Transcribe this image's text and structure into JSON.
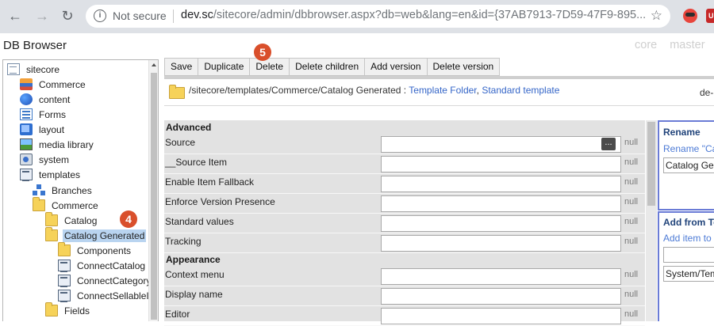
{
  "browser": {
    "security_label": "Not secure",
    "url_host": "dev.sc",
    "url_path": "/sitecore/admin/dbbrowser.aspx?db=web&lang=en&id={37AB7913-7D59-47F9-895..."
  },
  "app": {
    "title": "DB Browser",
    "databases": [
      "core",
      "master"
    ]
  },
  "tree": {
    "items": [
      {
        "label": "sitecore",
        "icon": "page-icon"
      },
      {
        "label": "Commerce",
        "icon": "commerce-icon"
      },
      {
        "label": "content",
        "icon": "content-icon"
      },
      {
        "label": "Forms",
        "icon": "forms-icon"
      },
      {
        "label": "layout",
        "icon": "layout-icon"
      },
      {
        "label": "media library",
        "icon": "media-icon"
      },
      {
        "label": "system",
        "icon": "system-icon"
      },
      {
        "label": "templates",
        "icon": "templates-icon"
      },
      {
        "label": "Branches",
        "icon": "branches-icon"
      },
      {
        "label": "Commerce",
        "icon": "folder-icon"
      },
      {
        "label": "Catalog",
        "icon": "folder-icon"
      },
      {
        "label": "Catalog Generated",
        "icon": "folder-icon",
        "selected": true
      },
      {
        "label": "Components",
        "icon": "folder-icon"
      },
      {
        "label": "ConnectCatalog",
        "icon": "template-icon"
      },
      {
        "label": "ConnectCategory",
        "icon": "template-icon"
      },
      {
        "label": "ConnectSellableIte",
        "icon": "template-icon"
      },
      {
        "label": "Fields",
        "icon": "folder-icon"
      }
    ]
  },
  "toolbar": {
    "save": "Save",
    "duplicate": "Duplicate",
    "delete": "Delete",
    "delete_children": "Delete children",
    "add_version": "Add version",
    "delete_version": "Delete version"
  },
  "item": {
    "path": "/sitecore/templates/Commerce/Catalog Generated",
    "separator": " : ",
    "template_link": "Template Folder",
    "comma": ", ",
    "standard_link": "Standard template",
    "lang_trunc": "de-"
  },
  "fields": {
    "advanced_header": "Advanced",
    "appearance_header": "Appearance",
    "null_label": "null",
    "dots": "...",
    "advanced": [
      {
        "label": "Source",
        "value": ""
      },
      {
        "label": "__Source Item",
        "value": ""
      },
      {
        "label": "Enable Item Fallback",
        "value": ""
      },
      {
        "label": "Enforce Version Presence",
        "value": ""
      },
      {
        "label": "Standard values",
        "value": ""
      },
      {
        "label": "Tracking",
        "value": ""
      }
    ],
    "appearance": [
      {
        "label": "Context menu",
        "value": ""
      },
      {
        "label": "Display name",
        "value": ""
      },
      {
        "label": "Editor",
        "value": ""
      }
    ]
  },
  "rename_panel": {
    "title": "Rename",
    "subtitle": "Rename \"Cat",
    "input_value": "Catalog Gene"
  },
  "add_panel": {
    "title": "Add from Te",
    "subtitle": "Add item to \"",
    "input_value": "",
    "template_value": "System/Tem"
  },
  "badges": {
    "delete_step": "5",
    "tree_step": "4"
  },
  "colors": {
    "accent": "#6a7bd6",
    "badge": "#d94f2b",
    "link": "#3566c8",
    "selection": "#b9d4f0"
  }
}
